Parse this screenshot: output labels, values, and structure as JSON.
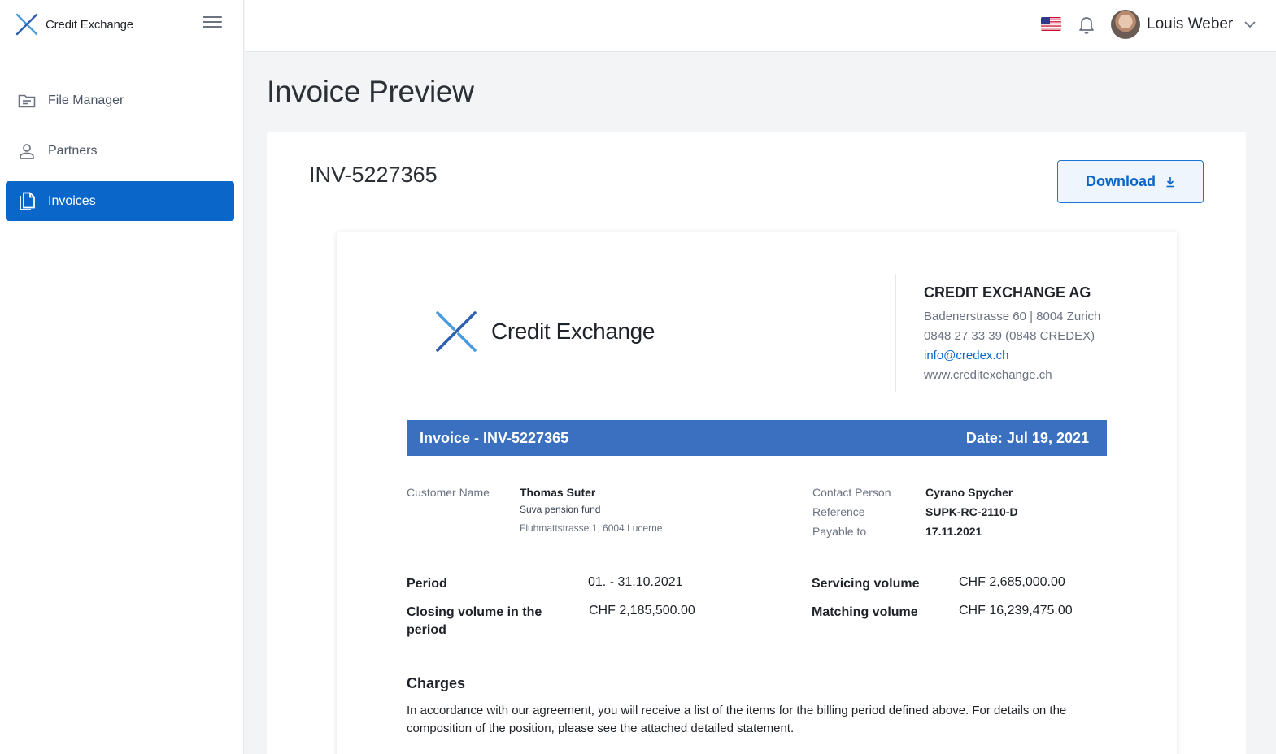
{
  "app": {
    "brand_name": "Credit Exchange"
  },
  "sidebar": {
    "items": [
      {
        "label": "File Manager",
        "icon": "folder-icon",
        "active": false
      },
      {
        "label": "Partners",
        "icon": "person-icon",
        "active": false
      },
      {
        "label": "Invoices",
        "icon": "documents-icon",
        "active": true
      }
    ]
  },
  "topbar": {
    "user_name": "Louis Weber",
    "language": "en-US"
  },
  "page": {
    "title": "Invoice Preview"
  },
  "invoice_card": {
    "id": "INV-5227365",
    "download_label": "Download"
  },
  "document": {
    "logo_text": "Credit Exchange",
    "company": {
      "name": "CREDIT EXCHANGE AG",
      "address": "Badenerstrasse 60 | 8004 Zurich",
      "phone": "0848 27 33 39 (0848 CREDEX)",
      "email": "info@credex.ch",
      "website": "www.creditexchange.ch"
    },
    "banner": {
      "title": "Invoice - INV-5227365",
      "date": "Date: Jul 19, 2021"
    },
    "customer": {
      "label": "Customer Name",
      "name": "Thomas Suter",
      "org": "Suva pension fund",
      "address": "Fluhmattstrasse 1, 6004 Lucerne"
    },
    "contact": {
      "contact_label": "Contact Person",
      "contact_value": "Cyrano Spycher",
      "reference_label": "Reference",
      "reference_value": "SUPK-RC-2110-D",
      "payable_label": "Payable to",
      "payable_value": "17.11.2021"
    },
    "summary": {
      "period_label": "Period",
      "period_value": "01. - 31.10.2021",
      "closing_label": "Closing volume in the period",
      "closing_value": "CHF 2,185,500.00",
      "servicing_label": "Servicing volume",
      "servicing_value": "CHF 2,685,000.00",
      "matching_label": "Matching volume",
      "matching_value": "CHF 16,239,475.00"
    },
    "charges": {
      "title": "Charges",
      "text": "In accordance with our agreement, you will receive a list of the items for the billing period defined above. For details on the composition of the position, please see the attached detailed statement."
    }
  },
  "colors": {
    "accent": "#0a66c9",
    "banner": "#3a70bf",
    "logo_light": "#4a9ae0",
    "logo_dark": "#2f5fb0"
  }
}
